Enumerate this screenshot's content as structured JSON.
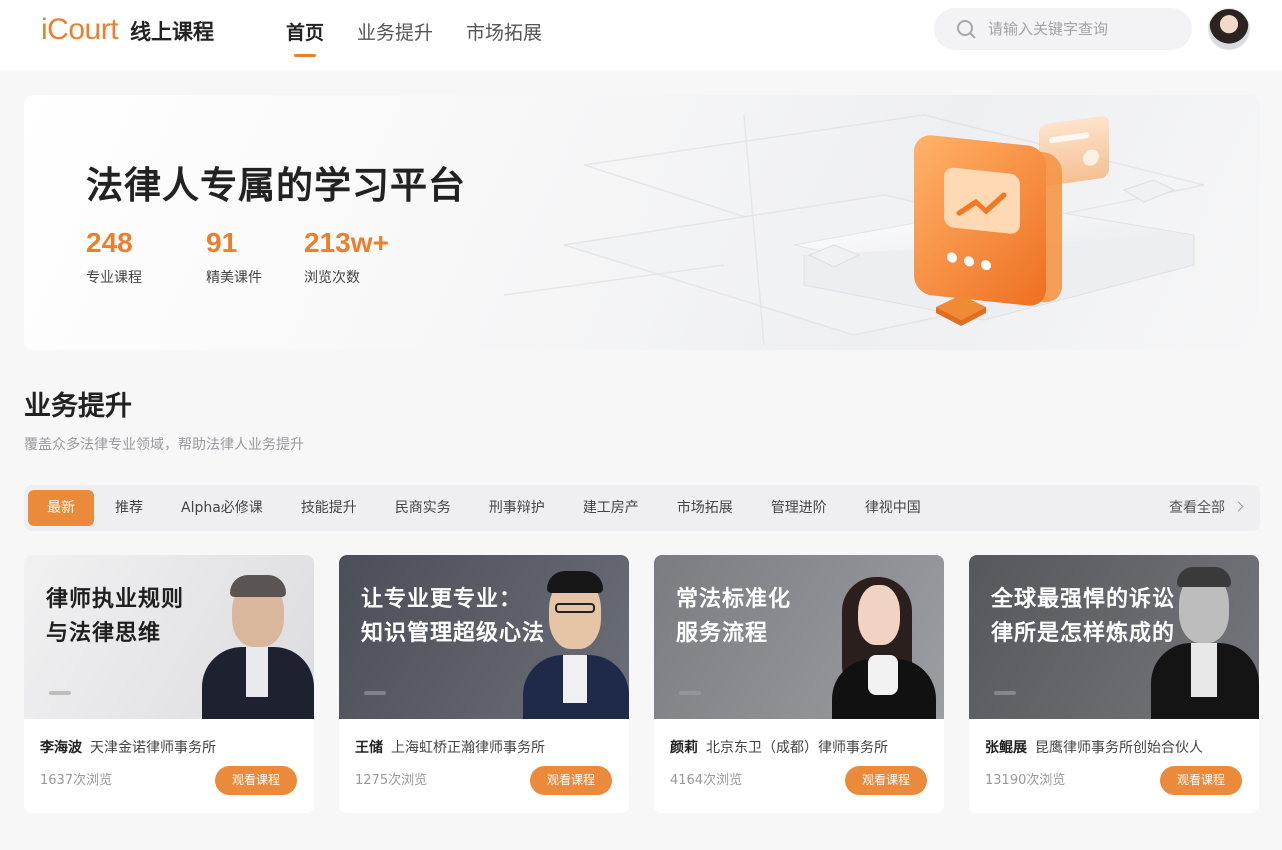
{
  "header": {
    "logo_brand": "iCourt",
    "logo_sub": "线上课程",
    "nav": [
      {
        "label": "首页",
        "active": true
      },
      {
        "label": "业务提升",
        "active": false
      },
      {
        "label": "市场拓展",
        "active": false
      }
    ],
    "search_placeholder": "请输入关键字查询"
  },
  "banner": {
    "title": "法律人专属的学习平台",
    "stats": [
      {
        "value": "248",
        "label": "专业课程"
      },
      {
        "value": "91",
        "label": "精美课件"
      },
      {
        "value": "213w+",
        "label": "浏览次数"
      }
    ]
  },
  "section": {
    "title": "业务提升",
    "subtitle": "覆盖众多法律专业领域，帮助法律人业务提升",
    "filters": [
      "最新",
      "推荐",
      "Alpha必修课",
      "技能提升",
      "民商实务",
      "刑事辩护",
      "建工房产",
      "市场拓展",
      "管理进阶",
      "律视中国"
    ],
    "active_filter": "最新",
    "view_all": "查看全部"
  },
  "courses": [
    {
      "cover_title": "律师执业规则\n与法律思维",
      "name": "李海波",
      "org": "天津金诺律师事务所",
      "views": "1637次浏览",
      "button": "观看课程",
      "theme": "light"
    },
    {
      "cover_title": "让专业更专业：\n知识管理超级心法",
      "name": "王储",
      "org": "上海虹桥正瀚律师事务所",
      "views": "1275次浏览",
      "button": "观看课程",
      "theme": "dark"
    },
    {
      "cover_title": "常法标准化\n服务流程",
      "name": "颜莉",
      "org": "北京东卫（成都）律师事务所",
      "views": "4164次浏览",
      "button": "观看课程",
      "theme": "mid"
    },
    {
      "cover_title": "全球最强悍的诉讼\n律所是怎样炼成的",
      "name": "张鲲展",
      "org": "昆鹰律师事务所创始合伙人",
      "views": "13190次浏览",
      "button": "观看课程",
      "theme": "dark"
    }
  ],
  "colors": {
    "accent": "#ec7f2c",
    "button": "#ec8a3b"
  }
}
